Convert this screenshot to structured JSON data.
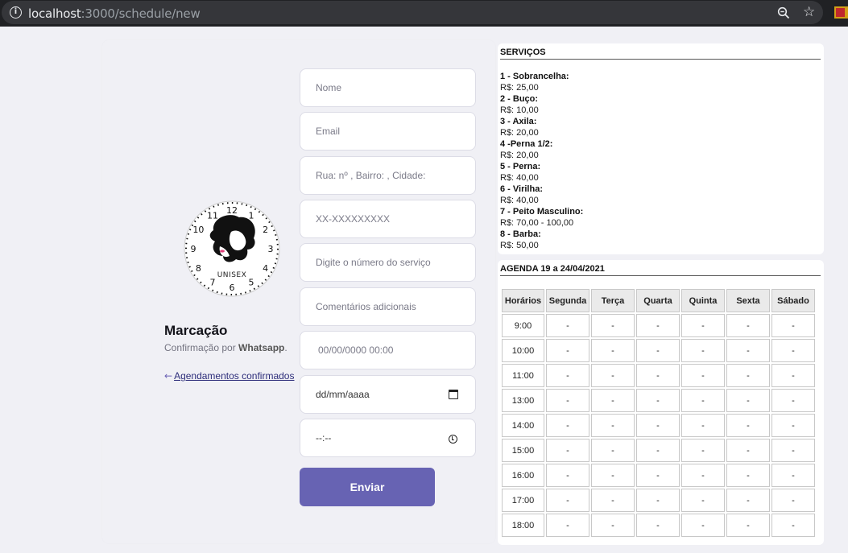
{
  "browser": {
    "url_host": "localhost",
    "url_rest": ":3000/schedule/new"
  },
  "form": {
    "title": "Marcação",
    "subtitle_prefix": "Confirmação por ",
    "subtitle_bold": "Whatsapp",
    "subtitle_suffix": ".",
    "back_link": "Agendamentos confirmados",
    "fields": {
      "name": "Nome",
      "email": "Email",
      "address": "Rua:  nº , Bairro:  , Cidade:",
      "phone": "XX-XXXXXXXXX",
      "service": "Digite o número do serviço",
      "comments": "Comentários adicionais",
      "datetime": "00/00/0000 00:00",
      "date": "dd/mm/aaaa",
      "time": "--:--"
    },
    "submit_label": "Enviar"
  },
  "services": {
    "title": "SERVIÇOS",
    "items": [
      {
        "name": "1 - Sobrancelha:",
        "price": "R$: 25,00"
      },
      {
        "name": "2 - Buço:",
        "price": "R$: 10,00"
      },
      {
        "name": "3 - Axila:",
        "price": "R$: 20,00"
      },
      {
        "name": "4 -Perna 1/2:",
        "price": "R$: 20,00"
      },
      {
        "name": "5 - Perna:",
        "price": "R$: 40,00"
      },
      {
        "name": "6 - Virilha:",
        "price": "R$: 40,00"
      },
      {
        "name": "7 - Peito Masculino:",
        "price": "R$: 70,00 - 100,00"
      },
      {
        "name": "8 - Barba:",
        "price": "R$: 50,00"
      }
    ]
  },
  "agenda": {
    "title": "AGENDA 19 a 24/04/2021",
    "headers": [
      "Horários",
      "Segunda",
      "Terça",
      "Quarta",
      "Quinta",
      "Sexta",
      "Sábado"
    ],
    "rows": [
      [
        "9:00",
        "-",
        "-",
        "-",
        "-",
        "-",
        "-"
      ],
      [
        "10:00",
        "-",
        "-",
        "-",
        "-",
        "-",
        "-"
      ],
      [
        "11:00",
        "-",
        "-",
        "-",
        "-",
        "-",
        "-"
      ],
      [
        "13:00",
        "-",
        "-",
        "-",
        "-",
        "-",
        "-"
      ],
      [
        "14:00",
        "-",
        "-",
        "-",
        "-",
        "-",
        "-"
      ],
      [
        "15:00",
        "-",
        "-",
        "-",
        "-",
        "-",
        "-"
      ],
      [
        "16:00",
        "-",
        "-",
        "-",
        "-",
        "-",
        "-"
      ],
      [
        "17:00",
        "-",
        "-",
        "-",
        "-",
        "-",
        "-"
      ],
      [
        "18:00",
        "-",
        "-",
        "-",
        "-",
        "-",
        "-"
      ]
    ]
  },
  "logo": {
    "text": "UNISEX",
    "clock_numbers": [
      "12",
      "1",
      "2",
      "3",
      "4",
      "5",
      "6",
      "7",
      "8",
      "9",
      "10",
      "11"
    ]
  }
}
